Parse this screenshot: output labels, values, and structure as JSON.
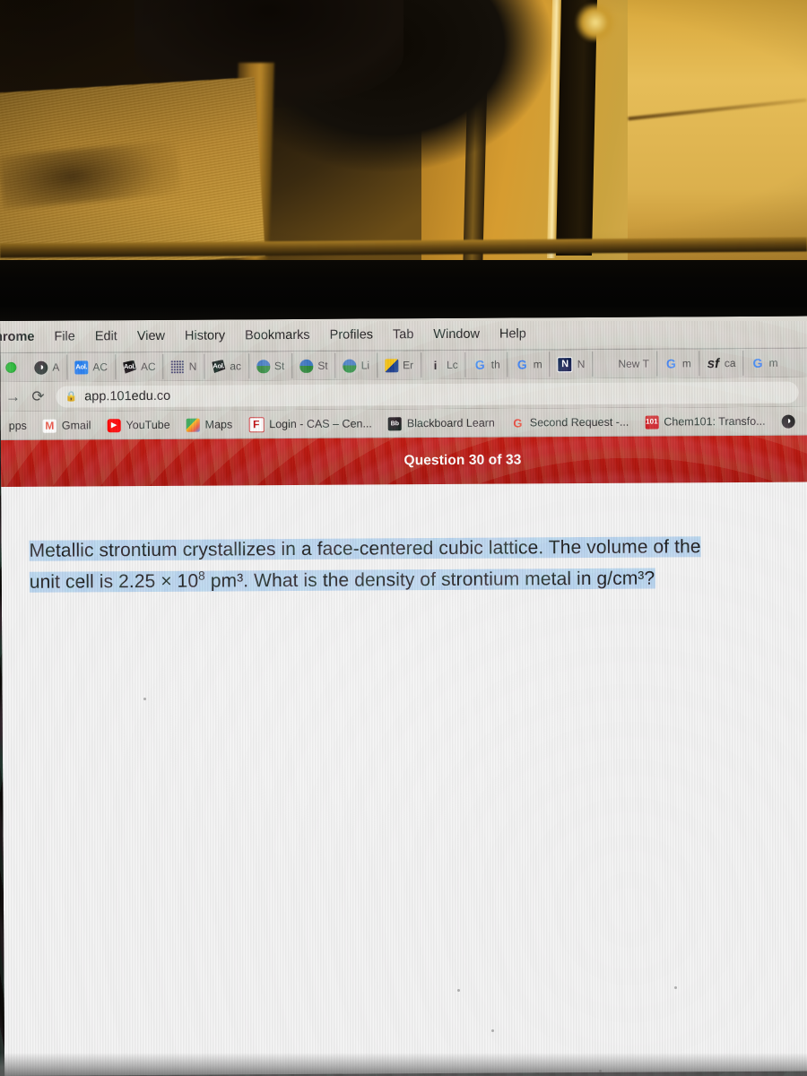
{
  "window": {
    "traffic_light_color": "#2fbd3e"
  },
  "menubar": {
    "items": [
      {
        "label": "hrome",
        "app": true
      },
      {
        "label": "File"
      },
      {
        "label": "Edit"
      },
      {
        "label": "View"
      },
      {
        "label": "History"
      },
      {
        "label": "Bookmarks"
      },
      {
        "label": "Profiles"
      },
      {
        "label": "Tab"
      },
      {
        "label": "Window"
      },
      {
        "label": "Help"
      }
    ]
  },
  "tabs": [
    {
      "label": "A",
      "icon": "globe-icon",
      "icon_class": "globe",
      "icon_text": "◑"
    },
    {
      "label": "AC",
      "icon": "aol-icon",
      "icon_class": "aol-blue",
      "icon_text": "Aol."
    },
    {
      "label": "AC",
      "icon": "aol-dark-icon",
      "icon_class": "aol-dark",
      "icon_text": "Aol."
    },
    {
      "label": "N",
      "icon": "dots-icon",
      "icon_class": "dots",
      "icon_text": ""
    },
    {
      "label": "ac",
      "icon": "aol-dark-icon",
      "icon_class": "aol-dark",
      "icon_text": "Aol."
    },
    {
      "label": "St",
      "icon": "book-icon",
      "icon_class": "book",
      "icon_text": ""
    },
    {
      "label": "St",
      "icon": "book-icon",
      "icon_class": "book",
      "icon_text": ""
    },
    {
      "label": "Li",
      "icon": "book-icon",
      "icon_class": "book",
      "icon_text": ""
    },
    {
      "label": "Er",
      "icon": "yellow-blue-icon",
      "icon_class": "er",
      "icon_text": ""
    },
    {
      "label": "Lc",
      "icon": "info-icon",
      "icon_class": "info",
      "icon_text": "i"
    },
    {
      "label": "th",
      "icon": "google-icon",
      "icon_class": "g",
      "icon_text": "G"
    },
    {
      "label": "m",
      "icon": "google-icon",
      "icon_class": "g",
      "icon_text": "G"
    },
    {
      "label": "N",
      "icon": "notion-icon",
      "icon_class": "n",
      "icon_text": "N"
    },
    {
      "label": "New T",
      "icon": "blank-icon",
      "icon_class": "none",
      "icon_text": ""
    },
    {
      "label": "m",
      "icon": "google-icon",
      "icon_class": "g",
      "icon_text": "G"
    },
    {
      "label": "ca",
      "icon": "sf-icon",
      "icon_class": "sf",
      "icon_text": "sf"
    },
    {
      "label": "m",
      "icon": "google-icon",
      "icon_class": "g",
      "icon_text": "G"
    }
  ],
  "toolbar": {
    "forward_icon": "→",
    "reload_icon": "⟳",
    "lock_icon": "🔒",
    "url": "app.101edu.co"
  },
  "bookmarks": [
    {
      "label": "pps",
      "icon": "apps-icon",
      "icon_class": "none",
      "icon_text": ""
    },
    {
      "label": "Gmail",
      "icon": "gmail-icon",
      "icon_class": "gmail",
      "icon_text": "M"
    },
    {
      "label": "YouTube",
      "icon": "youtube-icon",
      "icon_class": "yt",
      "icon_text": "▶"
    },
    {
      "label": "Maps",
      "icon": "maps-icon",
      "icon_class": "maps",
      "icon_text": ""
    },
    {
      "label": "Login - CAS – Cen...",
      "icon": "cas-icon",
      "icon_class": "cas",
      "icon_text": "F"
    },
    {
      "label": "Blackboard Learn",
      "icon": "blackboard-icon",
      "icon_class": "bb",
      "icon_text": "Bb"
    },
    {
      "label": "Second Request -...",
      "icon": "google-icon",
      "icon_class": "gg",
      "icon_text": "G"
    },
    {
      "label": "Chem101: Transfo...",
      "icon": "chem101-icon",
      "icon_class": "c101",
      "icon_text": "101"
    },
    {
      "label": "",
      "icon": "globe-icon",
      "icon_class": "globe",
      "icon_text": "◑"
    }
  ],
  "header": {
    "question_counter": "Question 30 of 33",
    "bar_color": "#b5170f"
  },
  "question": {
    "line1": "Metallic strontium crystallizes in a face-centered cubic lattice. The",
    "line2_a": "volume of the unit cell is 2.25 × 10",
    "line2_sup": "8",
    "line2_b": " pm³. What is the density of",
    "line3": "strontium metal in g/cm³?",
    "selection_color": "#b8d4ef"
  }
}
